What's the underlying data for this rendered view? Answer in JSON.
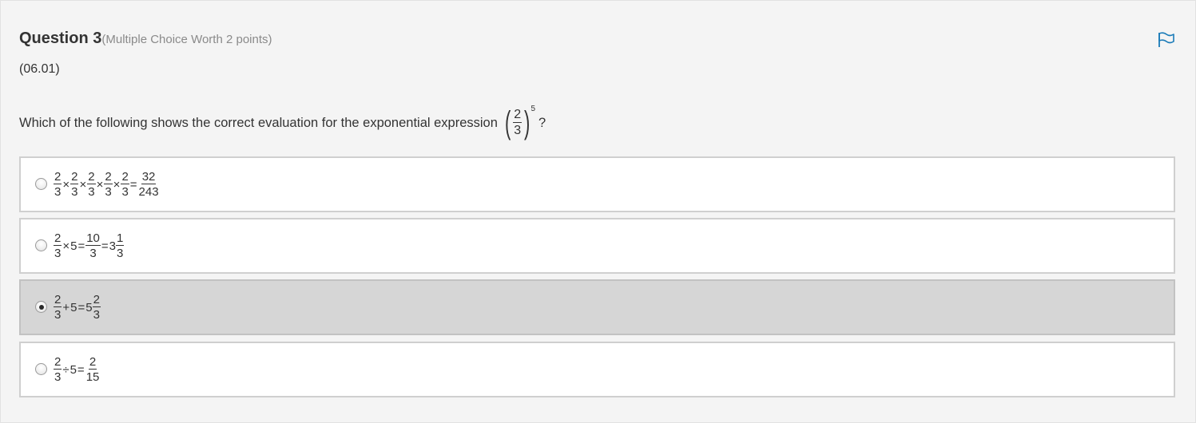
{
  "question": {
    "title": "Question 3",
    "worth": "(Multiple Choice Worth 2 points)",
    "code": "(06.01)",
    "prompt": "Which of the following shows the correct evaluation for the exponential expression",
    "expression": {
      "numerator": "2",
      "denominator": "3",
      "exponent": "5"
    },
    "prompt_end": "?",
    "flag_icon": "flag-icon"
  },
  "options": [
    {
      "selected": false,
      "tokens": [
        {
          "frac": [
            "2",
            "3"
          ]
        },
        {
          "op": "×"
        },
        {
          "frac": [
            "2",
            "3"
          ]
        },
        {
          "op": "×"
        },
        {
          "frac": [
            "2",
            "3"
          ]
        },
        {
          "op": "×"
        },
        {
          "frac": [
            "2",
            "3"
          ]
        },
        {
          "op": "×"
        },
        {
          "frac": [
            "2",
            "3"
          ]
        },
        {
          "op": "="
        },
        {
          "frac": [
            "32",
            "243"
          ]
        }
      ]
    },
    {
      "selected": false,
      "tokens": [
        {
          "frac": [
            "2",
            "3"
          ]
        },
        {
          "op": "×"
        },
        {
          "text": "5"
        },
        {
          "op": "="
        },
        {
          "frac": [
            "10",
            "3"
          ]
        },
        {
          "op": "="
        },
        {
          "text": "3"
        },
        {
          "frac": [
            "1",
            "3"
          ]
        }
      ]
    },
    {
      "selected": true,
      "tokens": [
        {
          "frac": [
            "2",
            "3"
          ]
        },
        {
          "op": "+"
        },
        {
          "text": "5"
        },
        {
          "op": "="
        },
        {
          "text": "5"
        },
        {
          "frac": [
            "2",
            "3"
          ]
        }
      ]
    },
    {
      "selected": false,
      "tokens": [
        {
          "frac": [
            "2",
            "3"
          ]
        },
        {
          "op": "÷"
        },
        {
          "text": "5"
        },
        {
          "op": "="
        },
        {
          "frac": [
            "2",
            "15"
          ]
        }
      ]
    }
  ]
}
